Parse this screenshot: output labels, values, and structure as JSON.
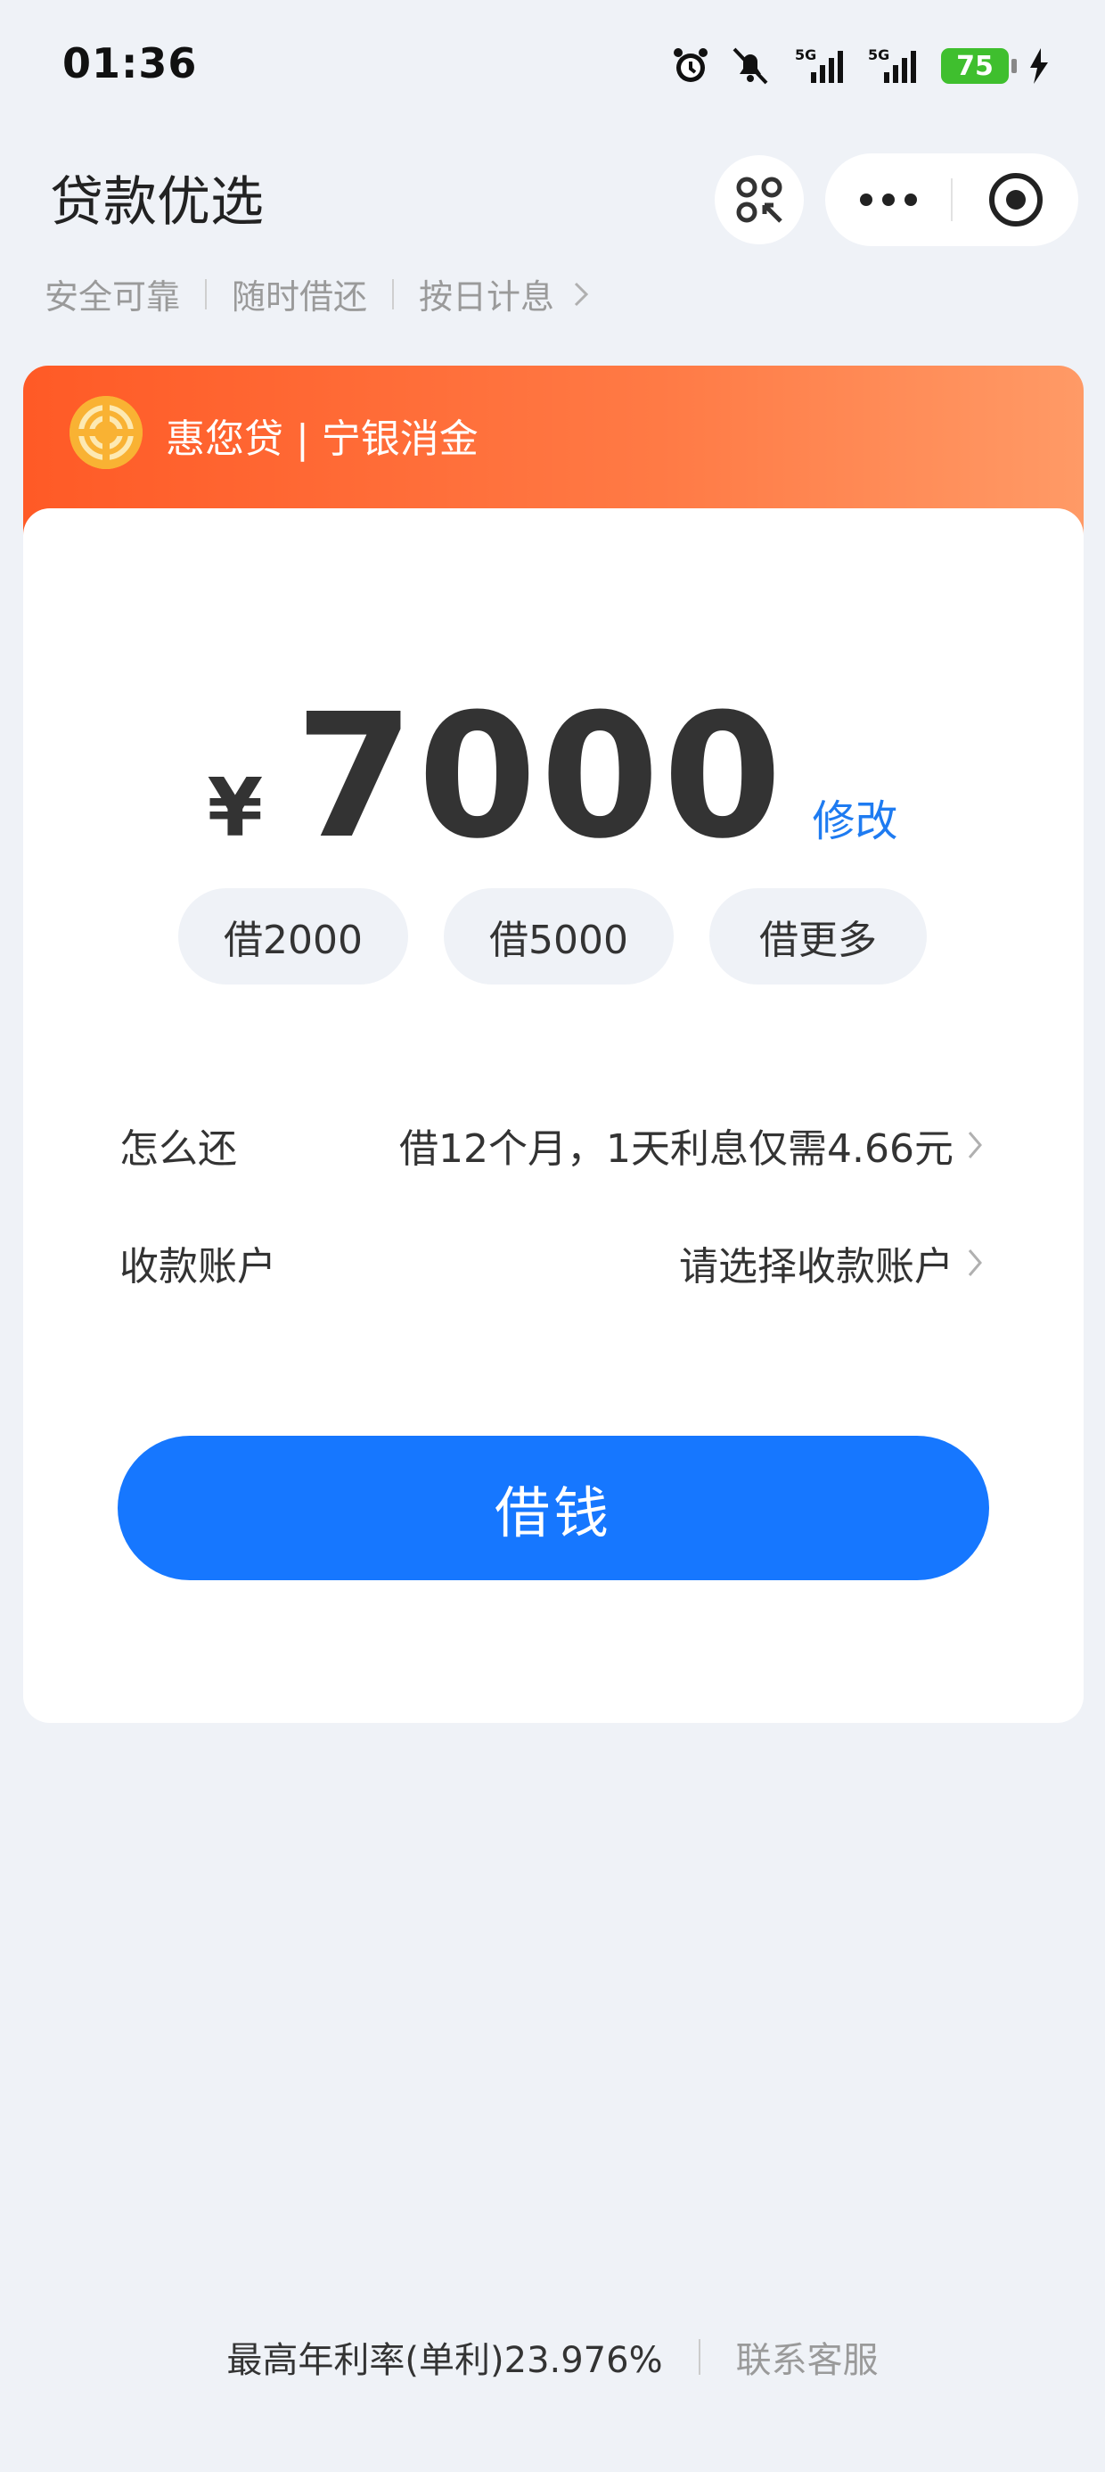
{
  "status_bar": {
    "time": "01:36",
    "battery": "75",
    "network_1": "5G",
    "network_2": "5G"
  },
  "header": {
    "title": "贷款优选"
  },
  "tags": [
    "安全可靠",
    "随时借还",
    "按日计息"
  ],
  "brand": {
    "name": "惠您贷 | 宁银消金",
    "accent": "#ff5a26"
  },
  "loan": {
    "currency": "¥",
    "amount": "7000",
    "modify_label": "修改",
    "quick_options": [
      "借2000",
      "借5000",
      "借更多"
    ],
    "repay_label": "怎么还",
    "repay_value": "借12个月，1天利息仅需4.66元",
    "account_label": "收款账户",
    "account_value": "请选择收款账户",
    "borrow_button": "借钱",
    "button_color": "#1677ff"
  },
  "footer": {
    "rate": "最高年利率(单利)23.976%",
    "service": "联系客服"
  }
}
